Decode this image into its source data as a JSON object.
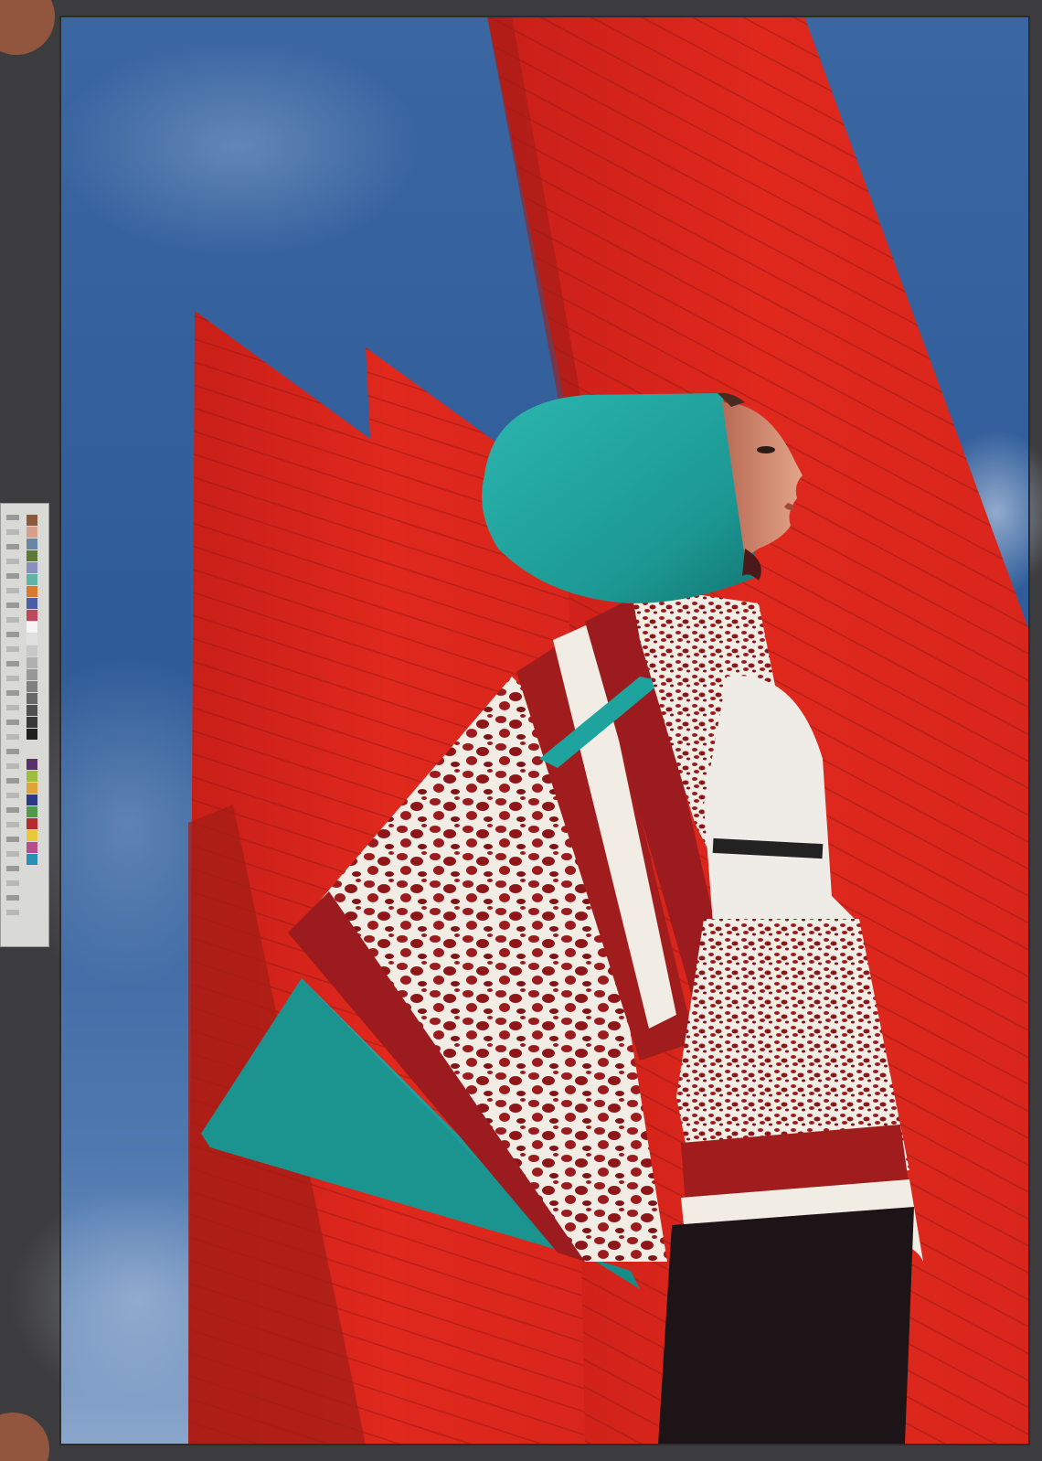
{
  "photo": {
    "subject": "fashion-photograph",
    "colors": {
      "sky": "#2f5c98",
      "sky_light": "#6f93c6",
      "wall_red": "#e0281d",
      "wall_shadow": "#a31d17",
      "teal": "#1fa39f",
      "print_red": "#9c1b1e",
      "cream": "#f1ece4",
      "mount": "#3c3b3d"
    }
  },
  "color_target": {
    "patches": [
      "#8b5a3c",
      "#d7a08c",
      "#6a86a6",
      "#5f7a37",
      "#8b8fbf",
      "#5fb4a6",
      "#d57b2b",
      "#4d5ea7",
      "#c1485c",
      "#5a316a",
      "#9ebd3d",
      "#e0a33b",
      "#2b3a86",
      "#4f9a4f",
      "#b62a30",
      "#e7c93a",
      "#b64c8d",
      "#2a8fb5"
    ]
  }
}
